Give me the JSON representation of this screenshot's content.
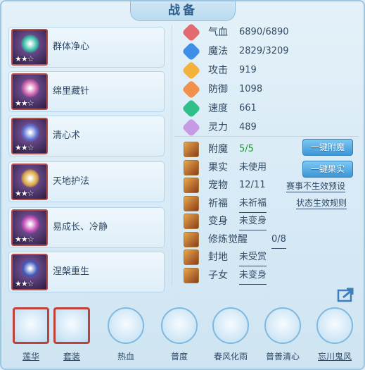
{
  "title": "战备",
  "skills": [
    {
      "label": "群体净心",
      "stars": "★★☆",
      "icon": "skill-icon-group-purify",
      "color": "#2fb9a2"
    },
    {
      "label": "绵里藏针",
      "stars": "★★☆",
      "icon": "skill-icon-hidden-needle",
      "color": "#c95aa6"
    },
    {
      "label": "清心术",
      "stars": "★★☆",
      "icon": "skill-icon-clear-mind",
      "color": "#5a6fd0"
    },
    {
      "label": "天地护法",
      "stars": "★★☆",
      "icon": "skill-icon-heaven-earth-guard",
      "color": "#d9a43b"
    },
    {
      "label": "易成长、冷静",
      "stars": "★★☆",
      "icon": "skill-icon-growth-calm",
      "color": "#c24ab5"
    },
    {
      "label": "涅槃重生",
      "stars": "★★☆",
      "icon": "skill-icon-nirvana-rebirth",
      "color": "#3b57b8"
    }
  ],
  "stats": [
    {
      "name": "气血",
      "value": "6890/6890",
      "color": "#e36b6f"
    },
    {
      "name": "魔法",
      "value": "2829/3209",
      "color": "#3f8fe8"
    },
    {
      "name": "攻击",
      "value": "919",
      "color": "#f2b23b"
    },
    {
      "name": "防御",
      "value": "1098",
      "color": "#f0904a"
    },
    {
      "name": "速度",
      "value": "661",
      "color": "#2fc08a"
    },
    {
      "name": "灵力",
      "value": "489",
      "color": "#c79ae6"
    }
  ],
  "props": [
    {
      "name": "附魔",
      "value": "5/5"
    },
    {
      "name": "果实",
      "value": "未使用"
    },
    {
      "name": "宠物",
      "value": "12/11"
    },
    {
      "name": "祈福",
      "value": "未祈福"
    },
    {
      "name": "变身",
      "value": "未变身"
    },
    {
      "name": "修炼觉醒",
      "value": "0/8"
    },
    {
      "name": "封地",
      "value": "未受赏"
    },
    {
      "name": "子女",
      "value": "未变身"
    }
  ],
  "buttons": {
    "enchant": "一键附魔",
    "fruit": "一键果实"
  },
  "links": {
    "event_preset": "赛事不生效预设",
    "status_rule": "状态生效规则"
  },
  "bottom": [
    {
      "label": "莲华",
      "icon": "lotus-icon"
    },
    {
      "label": "套装",
      "icon": "armor-set-icon"
    },
    {
      "label": "热血",
      "icon": "hot-blood-icon"
    },
    {
      "label": "普度",
      "icon": "salvation-icon"
    },
    {
      "label": "春风化雨",
      "icon": "spring-breeze-icon"
    },
    {
      "label": "普善清心",
      "icon": "kindness-icon"
    },
    {
      "label": "忘川鬼风",
      "icon": "ghost-wind-icon"
    }
  ]
}
